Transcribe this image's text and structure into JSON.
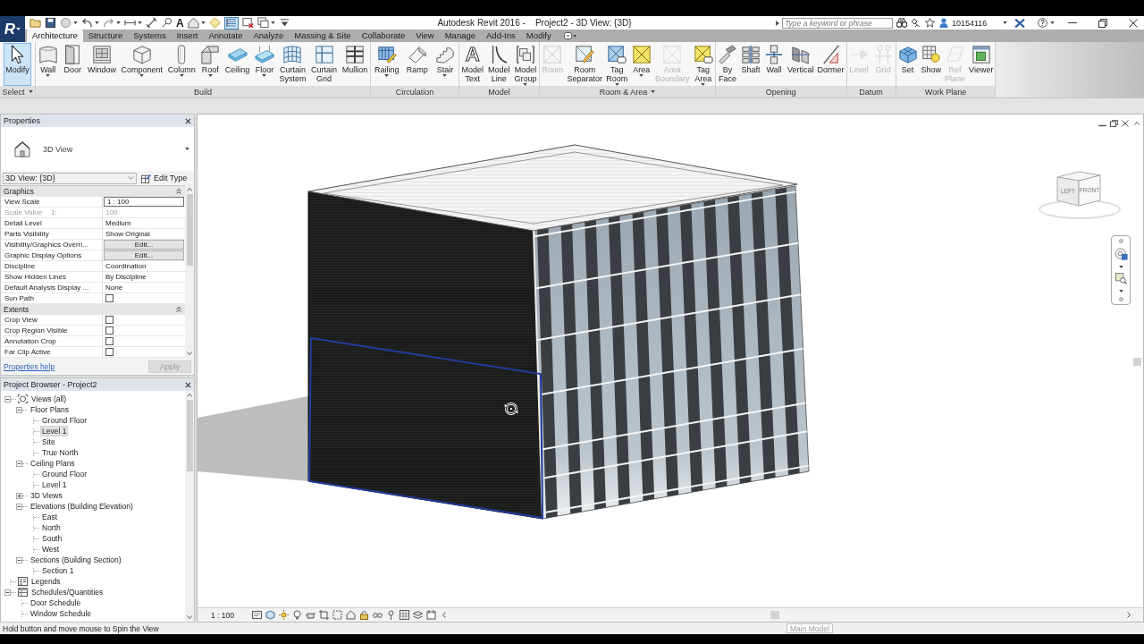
{
  "title_bar": {
    "app_glyph": "R",
    "quick_access": {
      "text_glyph": "A",
      "thin_lines_selected": true
    },
    "title": "Autodesk Revit 2016 -    Project2 - 3D View: {3D}",
    "search": {
      "placeholder": "Type a keyword or phrase"
    },
    "user": "10154116"
  },
  "ribbon": {
    "tabs": [
      {
        "label": "Architecture",
        "selected": true
      },
      {
        "label": "Structure",
        "selected": false
      },
      {
        "label": "Systems",
        "selected": false
      },
      {
        "label": "Insert",
        "selected": false
      },
      {
        "label": "Annotate",
        "selected": false
      },
      {
        "label": "Analyze",
        "selected": false
      },
      {
        "label": "Massing & Site",
        "selected": false
      },
      {
        "label": "Collaborate",
        "selected": false
      },
      {
        "label": "View",
        "selected": false
      },
      {
        "label": "Manage",
        "selected": false
      },
      {
        "label": "Add-Ins",
        "selected": false
      },
      {
        "label": "Modify",
        "selected": false
      }
    ],
    "panels": [
      {
        "label": "Select",
        "dropdown": true,
        "tools": [
          {
            "label": "Modify",
            "selected": true,
            "disabled": false,
            "dropdown": false
          }
        ]
      },
      {
        "label": "Build",
        "dropdown": false,
        "tools": [
          {
            "label": "Wall",
            "selected": false,
            "disabled": false,
            "dropdown": true
          },
          {
            "label": "Door",
            "selected": false,
            "disabled": false,
            "dropdown": false
          },
          {
            "label": "Window",
            "selected": false,
            "disabled": false,
            "dropdown": false
          },
          {
            "label": "Component",
            "selected": false,
            "disabled": false,
            "dropdown": true
          },
          {
            "label": "Column",
            "selected": false,
            "disabled": false,
            "dropdown": true
          },
          {
            "label": "Roof",
            "selected": false,
            "disabled": false,
            "dropdown": true
          },
          {
            "label": "Ceiling",
            "selected": false,
            "disabled": false,
            "dropdown": false
          },
          {
            "label": "Floor",
            "selected": false,
            "disabled": false,
            "dropdown": true
          },
          {
            "label": "Curtain System",
            "selected": false,
            "disabled": false,
            "dropdown": false
          },
          {
            "label": "Curtain Grid",
            "selected": false,
            "disabled": false,
            "dropdown": false
          },
          {
            "label": "Mullion",
            "selected": false,
            "disabled": false,
            "dropdown": false
          }
        ]
      },
      {
        "label": "Circulation",
        "dropdown": false,
        "tools": [
          {
            "label": "Railing",
            "selected": false,
            "disabled": false,
            "dropdown": true
          },
          {
            "label": "Ramp",
            "selected": false,
            "disabled": false,
            "dropdown": false
          },
          {
            "label": "Stair",
            "selected": false,
            "disabled": false,
            "dropdown": true
          }
        ]
      },
      {
        "label": "Model",
        "dropdown": false,
        "tools": [
          {
            "label": "Model Text",
            "glyph": "A",
            "selected": false,
            "disabled": false,
            "dropdown": false
          },
          {
            "label": "Model Line",
            "selected": false,
            "disabled": false,
            "dropdown": false
          },
          {
            "label": "Model Group",
            "selected": false,
            "disabled": false,
            "dropdown": true
          }
        ]
      },
      {
        "label": "Room & Area",
        "dropdown": true,
        "tools": [
          {
            "label": "Room",
            "selected": false,
            "disabled": true,
            "dropdown": false
          },
          {
            "label": "Room Separator",
            "selected": false,
            "disabled": false,
            "dropdown": false
          },
          {
            "label": "Tag Room",
            "selected": false,
            "disabled": false,
            "dropdown": true
          },
          {
            "label": "Area",
            "selected": false,
            "disabled": false,
            "dropdown": true
          },
          {
            "label": "Area Boundary",
            "selected": false,
            "disabled": true,
            "dropdown": false
          },
          {
            "label": "Tag Area",
            "selected": false,
            "disabled": false,
            "dropdown": true
          }
        ]
      },
      {
        "label": "Opening",
        "dropdown": false,
        "tools": [
          {
            "label": "By Face",
            "selected": false,
            "disabled": false,
            "dropdown": false
          },
          {
            "label": "Shaft",
            "selected": false,
            "disabled": false,
            "dropdown": false
          },
          {
            "label": "Wall",
            "selected": false,
            "disabled": false,
            "dropdown": false
          },
          {
            "label": "Vertical",
            "selected": false,
            "disabled": false,
            "dropdown": false
          },
          {
            "label": "Dormer",
            "selected": false,
            "disabled": false,
            "dropdown": false
          }
        ]
      },
      {
        "label": "Datum",
        "dropdown": false,
        "tools": [
          {
            "label": "Level",
            "selected": false,
            "disabled": true,
            "dropdown": false
          },
          {
            "label": "Grid",
            "selected": false,
            "disabled": true,
            "dropdown": false
          }
        ]
      },
      {
        "label": "Work Plane",
        "dropdown": false,
        "tools": [
          {
            "label": "Set",
            "selected": false,
            "disabled": false,
            "dropdown": false
          },
          {
            "label": "Show",
            "selected": false,
            "disabled": false,
            "dropdown": false
          },
          {
            "label": "Ref Plane",
            "selected": false,
            "disabled": true,
            "dropdown": false
          },
          {
            "label": "Viewer",
            "selected": false,
            "disabled": false,
            "dropdown": false
          }
        ]
      }
    ]
  },
  "properties": {
    "title": "Properties",
    "type_name": "3D View",
    "instance_selector": "3D View: {3D}",
    "edit_type": "Edit Type",
    "groups": [
      {
        "label": "Graphics",
        "expanded": true,
        "rows": [
          {
            "name": "View Scale",
            "value": "1 : 100",
            "kind": "input",
            "disabled": false
          },
          {
            "name": "Scale Value",
            "suffix": "1:",
            "value": "100",
            "kind": "text",
            "disabled": true
          },
          {
            "name": "Detail Level",
            "value": "Medium",
            "kind": "text",
            "disabled": false
          },
          {
            "name": "Parts Visibility",
            "value": "Show Original",
            "kind": "text",
            "disabled": false
          },
          {
            "name": "Visibility/Graphics Overri...",
            "value": "Edit...",
            "kind": "button",
            "disabled": false
          },
          {
            "name": "Graphic Display Options",
            "value": "Edit...",
            "kind": "button",
            "disabled": false
          },
          {
            "name": "Discipline",
            "value": "Coordination",
            "kind": "text",
            "disabled": false
          },
          {
            "name": "Show Hidden Lines",
            "value": "By Discipline",
            "kind": "text",
            "disabled": false
          },
          {
            "name": "Default Analysis Display ...",
            "value": "None",
            "kind": "text",
            "disabled": false
          },
          {
            "name": "Sun Path",
            "kind": "checkbox",
            "checked": false,
            "disabled": false
          }
        ]
      },
      {
        "label": "Extents",
        "expanded": true,
        "rows": [
          {
            "name": "Crop View",
            "kind": "checkbox",
            "checked": false,
            "disabled": false
          },
          {
            "name": "Crop Region Visible",
            "kind": "checkbox",
            "checked": false,
            "disabled": false
          },
          {
            "name": "Annotation Crop",
            "kind": "checkbox",
            "checked": false,
            "disabled": false
          },
          {
            "name": "Far Clip Active",
            "kind": "checkbox",
            "checked": false,
            "disabled": false
          }
        ]
      }
    ],
    "help_link": "Properties help",
    "apply": {
      "label": "Apply",
      "disabled": true
    }
  },
  "project_browser": {
    "title": "Project Browser - Project2",
    "tree": [
      {
        "label": "Views (all)",
        "kind": "views",
        "expanded": true,
        "selected": false,
        "children": [
          {
            "label": "Floor Plans",
            "expanded": true,
            "selected": false,
            "children": [
              {
                "label": "Ground Floor",
                "selected": false
              },
              {
                "label": "Level 1",
                "selected": true
              },
              {
                "label": "Site",
                "selected": false
              },
              {
                "label": "True North",
                "selected": false
              }
            ]
          },
          {
            "label": "Ceiling Plans",
            "expanded": true,
            "selected": false,
            "children": [
              {
                "label": "Ground Floor",
                "selected": false
              },
              {
                "label": "Level 1",
                "selected": false
              }
            ]
          },
          {
            "label": "3D Views",
            "expanded": false,
            "selected": false
          },
          {
            "label": "Elevations (Building Elevation)",
            "expanded": true,
            "selected": false,
            "children": [
              {
                "label": "East",
                "selected": false
              },
              {
                "label": "North",
                "selected": false
              },
              {
                "label": "South",
                "selected": false
              },
              {
                "label": "West",
                "selected": false
              }
            ]
          },
          {
            "label": "Sections (Building Section)",
            "expanded": true,
            "selected": false,
            "children": [
              {
                "label": "Section 1",
                "selected": false
              }
            ]
          }
        ]
      },
      {
        "label": "Legends",
        "kind": "legends",
        "selected": false
      },
      {
        "label": "Schedules/Quantities",
        "kind": "schedules",
        "expanded": true,
        "selected": false,
        "children": [
          {
            "label": "Door Schedule",
            "selected": false
          },
          {
            "label": "Window Schedule",
            "selected": false
          }
        ]
      }
    ]
  },
  "view": {
    "cube_faces": [
      {
        "label": "LEFT"
      },
      {
        "label": "FRONT"
      }
    ],
    "scale": "1 : 100"
  },
  "status_bar": {
    "hint": "Hold button and move mouse to Spin the View",
    "model": "Main Model"
  }
}
